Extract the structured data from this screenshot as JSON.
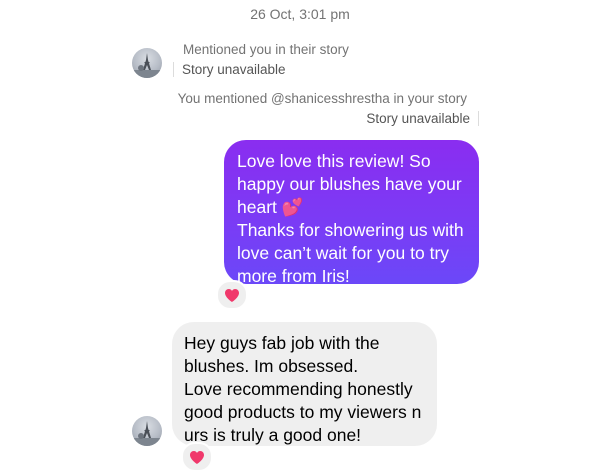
{
  "thread": {
    "timestamp": "26 Oct, 3:01 pm",
    "story_mention_in": {
      "text": "Mentioned you in their story",
      "status": "Story unavailable"
    },
    "story_mention_out": {
      "text": "You mentioned @shanicesshrestha in your story",
      "status": "Story unavailable"
    },
    "sent_message": {
      "text": "Love love this review! So happy our blushes have your heart 💕\nThanks for showering us with love can’t wait for you to try more from Iris!",
      "reaction": "heart-icon"
    },
    "received_message": {
      "text": "Hey guys fab job with the blushes. Im obsessed.\nLove recommending honestly good products to my viewers n urs is truly a good one!",
      "reaction": "heart-icon"
    }
  },
  "colors": {
    "sent_gradient_top": "#8a2df0",
    "sent_gradient_bottom": "#6b48f8",
    "received_bubble": "#efefef",
    "reaction_heart": "#f0386b",
    "muted_text": "#737373"
  }
}
